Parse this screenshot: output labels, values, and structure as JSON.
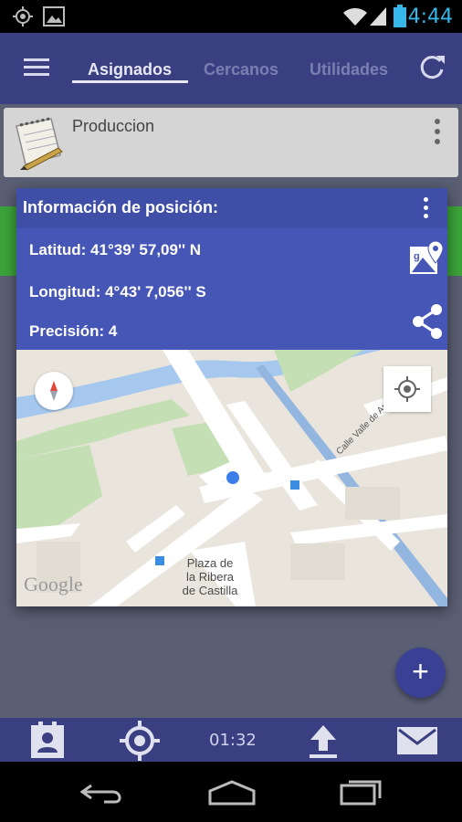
{
  "status_bar": {
    "time": "4:44"
  },
  "app_bar": {
    "tabs": [
      {
        "label": "Asignados",
        "active": true
      },
      {
        "label": "Cercanos",
        "active": false
      },
      {
        "label": "Utilidades",
        "active": false
      }
    ]
  },
  "list": {
    "items": [
      {
        "title": "Produccion"
      }
    ]
  },
  "position_dialog": {
    "title": "Información de posición:",
    "latitude": "Latitud: 41°39' 57,09'' N",
    "longitude": "Longitud: 4°43' 7,056'' S",
    "precision": "Precisión: 4"
  },
  "map": {
    "street_label": "Calle Valle de Arán",
    "place_label_line1": "Plaza de",
    "place_label_line2": "la Ribera",
    "place_label_line3": "de Castilla",
    "provider": "Google"
  },
  "bottom_bar": {
    "timer": "01:32"
  },
  "fab_icon": "+",
  "colors": {
    "app_bar": "#3a3f82",
    "dialog_header": "#3f4ea6",
    "dialog_info": "#4656b6",
    "accent_blue": "#36b7ea",
    "green_strip": "#3ca43a"
  }
}
